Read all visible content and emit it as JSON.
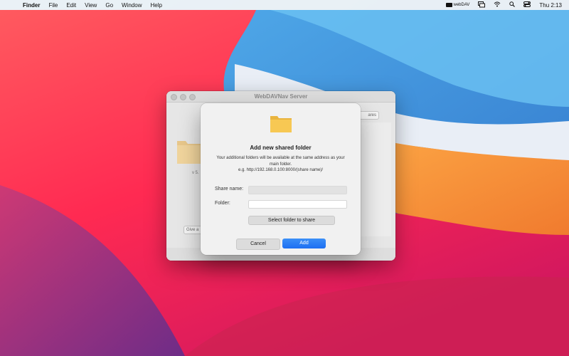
{
  "menubar": {
    "apple": "",
    "app": "Finder",
    "menus": [
      "File",
      "Edit",
      "View",
      "Go",
      "Window",
      "Help"
    ],
    "tray_folder_label": "webDAV",
    "clock": "Thu 2:13"
  },
  "background_window": {
    "title": "WebDAVNav Server",
    "version_text": "v 5.",
    "shares_label": "ares",
    "give_label": "Give a"
  },
  "sheet": {
    "title": "Add new shared folder",
    "desc_line1": "Your additional folders will be available at the same address as your",
    "desc_line2": "main folder.",
    "desc_line3": "e.g. http://192.168.0.100:8000/(share name)/",
    "share_name_label": "Share name:",
    "share_name_value": "",
    "folder_label": "Folder:",
    "folder_value": "",
    "select_folder_button": "Select folder to share",
    "cancel_button": "Cancel",
    "add_button": "Add"
  },
  "colors": {
    "accent": "#1d6ff2",
    "folder": "#f5c350"
  }
}
